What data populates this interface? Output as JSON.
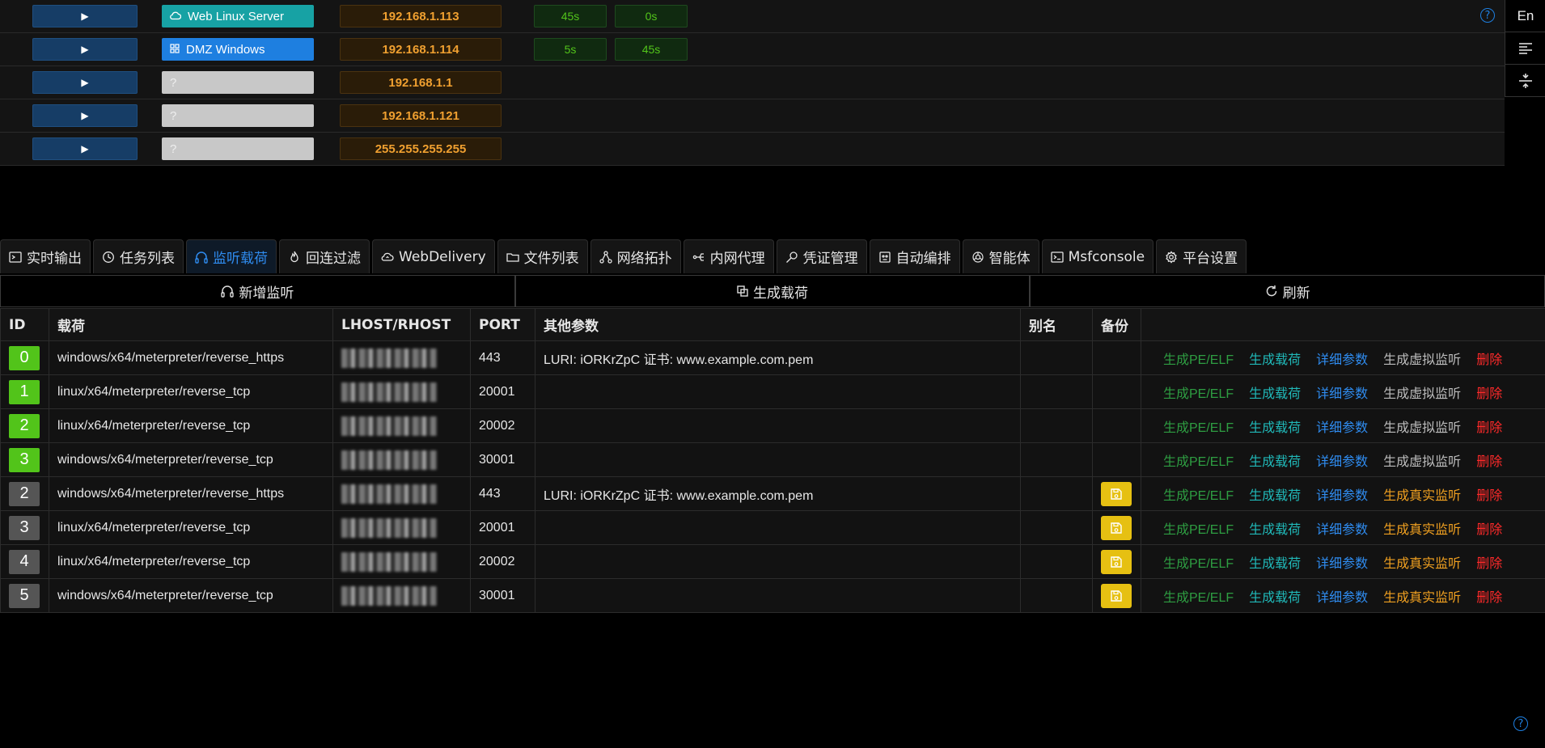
{
  "hosts": [
    {
      "name": "Web Linux Server",
      "style": "teal",
      "icon": "cloud-icon",
      "ip": "192.168.1.113",
      "badge1": "45s",
      "badge2": "0s"
    },
    {
      "name": "DMZ Windows",
      "style": "blue",
      "icon": "windows-icon",
      "ip": "192.168.1.114",
      "badge1": "5s",
      "badge2": "45s"
    },
    {
      "name": "?",
      "style": "gray",
      "ip": "192.168.1.1"
    },
    {
      "name": "?",
      "style": "gray",
      "ip": "192.168.1.121"
    },
    {
      "name": "?",
      "style": "gray",
      "ip": "255.255.255.255"
    }
  ],
  "side_toolbar": {
    "lang": "En",
    "align_icon": "align-left-icon",
    "split_icon": "split-icon"
  },
  "tabs": [
    {
      "label": "实时输出",
      "icon": "terminal-icon",
      "active": false
    },
    {
      "label": "任务列表",
      "icon": "clock-icon",
      "active": false
    },
    {
      "label": "监听载荷",
      "icon": "headphones-icon",
      "active": true
    },
    {
      "label": "回连过滤",
      "icon": "flame-icon",
      "active": false
    },
    {
      "label": "WebDelivery",
      "icon": "cloud-upload-icon",
      "active": false
    },
    {
      "label": "文件列表",
      "icon": "folder-icon",
      "active": false
    },
    {
      "label": "网络拓扑",
      "icon": "network-icon",
      "active": false
    },
    {
      "label": "内网代理",
      "icon": "proxy-icon",
      "active": false
    },
    {
      "label": "凭证管理",
      "icon": "key-icon",
      "active": false
    },
    {
      "label": "自动编排",
      "icon": "robot-icon",
      "active": false
    },
    {
      "label": "智能体",
      "icon": "ai-icon",
      "active": false
    },
    {
      "label": "Msfconsole",
      "icon": "console-icon",
      "active": false
    },
    {
      "label": "平台设置",
      "icon": "gear-icon",
      "active": false
    }
  ],
  "actions": {
    "add_listener": "新增监听",
    "generate_payload": "生成载荷",
    "refresh": "刷新"
  },
  "table": {
    "headers": [
      "ID",
      "载荷",
      "LHOST/RHOST",
      "PORT",
      "其他参数",
      "别名",
      "备份",
      ""
    ],
    "rows": [
      {
        "id": "0",
        "kind": "virtual",
        "payload": "windows/x64/meterpreter/reverse_https",
        "port": "443",
        "params": "LURI: iORKrZpC  证书: www.example.com.pem",
        "alias": "",
        "backup": false
      },
      {
        "id": "1",
        "kind": "virtual",
        "payload": "linux/x64/meterpreter/reverse_tcp",
        "port": "20001",
        "params": "",
        "alias": "",
        "backup": false
      },
      {
        "id": "2",
        "kind": "virtual",
        "payload": "linux/x64/meterpreter/reverse_tcp",
        "port": "20002",
        "params": "",
        "alias": "",
        "backup": false
      },
      {
        "id": "3",
        "kind": "virtual",
        "payload": "windows/x64/meterpreter/reverse_tcp",
        "port": "30001",
        "params": "",
        "alias": "",
        "backup": false
      },
      {
        "id": "2",
        "kind": "real",
        "payload": "windows/x64/meterpreter/reverse_https",
        "port": "443",
        "params": "LURI: iORKrZpC  证书: www.example.com.pem",
        "alias": "",
        "backup": true
      },
      {
        "id": "3",
        "kind": "real",
        "payload": "linux/x64/meterpreter/reverse_tcp",
        "port": "20001",
        "params": "",
        "alias": "",
        "backup": true
      },
      {
        "id": "4",
        "kind": "real",
        "payload": "linux/x64/meterpreter/reverse_tcp",
        "port": "20002",
        "params": "",
        "alias": "",
        "backup": true
      },
      {
        "id": "5",
        "kind": "real",
        "payload": "windows/x64/meterpreter/reverse_tcp",
        "port": "30001",
        "params": "",
        "alias": "",
        "backup": true
      }
    ],
    "ops": {
      "pe_elf": "生成PE/ELF",
      "gen": "生成载荷",
      "detail": "详细参数",
      "virtual": "生成虚拟监听",
      "real": "生成真实监听",
      "delete": "删除"
    }
  },
  "colors": {
    "accent": "#2f8cf0",
    "teal": "#17a2a4",
    "green": "#52c41a",
    "orange": "#f0a030",
    "red": "#ff2a2a",
    "yellow": "#e6c012"
  }
}
